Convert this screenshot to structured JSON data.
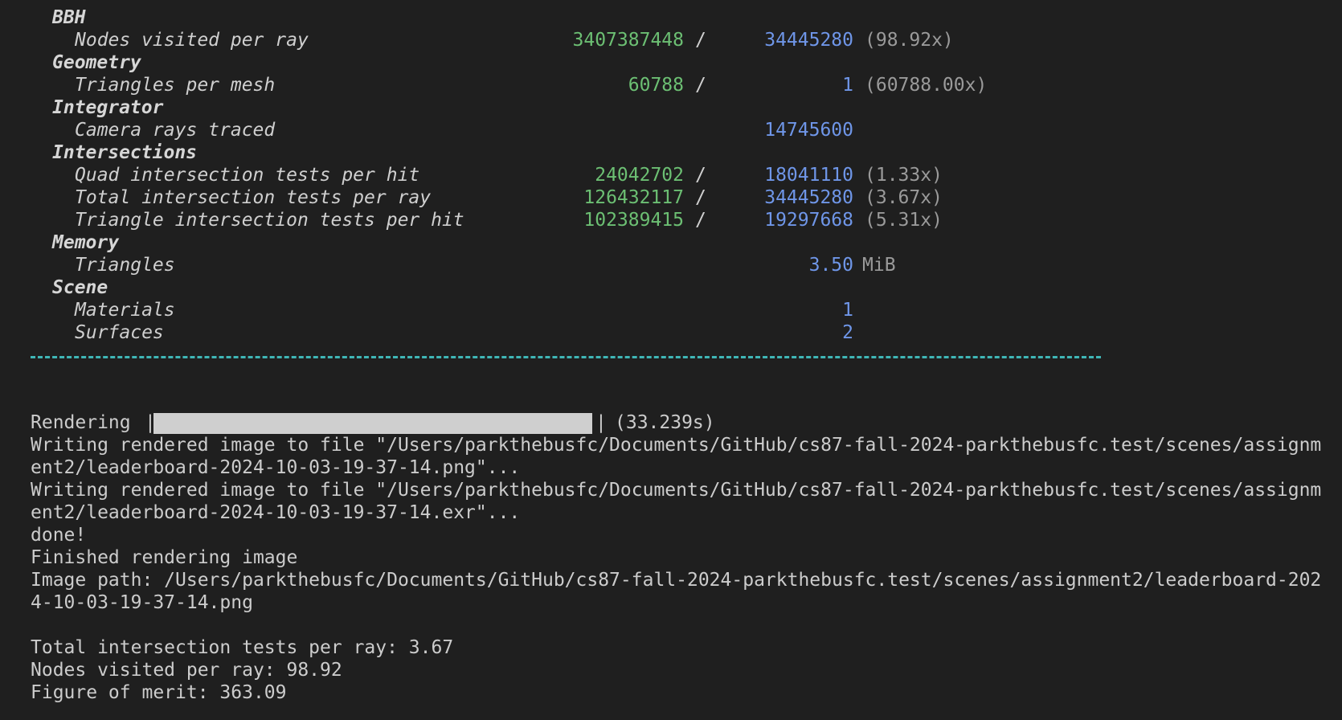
{
  "stats": {
    "bbh": {
      "category": "BBH",
      "nodes_label": "Nodes visited per ray",
      "nodes_num": "3407387448",
      "nodes_den": "34445280",
      "nodes_ratio": "(98.92x)"
    },
    "geometry": {
      "category": "Geometry",
      "tri_label": "Triangles per mesh",
      "tri_num": "60788",
      "tri_den": "1",
      "tri_ratio": "(60788.00x)"
    },
    "integrator": {
      "category": "Integrator",
      "rays_label": "Camera rays traced",
      "rays_value": "14745600"
    },
    "intersections": {
      "category": "Intersections",
      "quad_label": "Quad intersection tests per hit",
      "quad_num": "24042702",
      "quad_den": "18041110",
      "quad_ratio": "(1.33x)",
      "total_label": "Total intersection tests per ray",
      "total_num": "126432117",
      "total_den": "34445280",
      "total_ratio": "(3.67x)",
      "triangle_label": "Triangle intersection tests per hit",
      "triangle_num": "102389415",
      "triangle_den": "19297668",
      "triangle_ratio": "(5.31x)"
    },
    "memory": {
      "category": "Memory",
      "tri_label": "Triangles",
      "tri_value": "3.50",
      "tri_unit": "MiB"
    },
    "scene": {
      "category": "Scene",
      "materials_label": "Materials",
      "materials_value": "1",
      "surfaces_label": "Surfaces",
      "surfaces_value": "2"
    },
    "slash": "/"
  },
  "render": {
    "label": "Rendering",
    "pipe": "|",
    "progress_fraction": 1.0,
    "duration": "(33.239s)"
  },
  "log": [
    "Writing rendered image to file \"/Users/parkthebusfc/Documents/GitHub/cs87-fall-2024-parkthebusfc.test/scenes/assignm",
    "ent2/leaderboard-2024-10-03-19-37-14.png\"...",
    "Writing rendered image to file \"/Users/parkthebusfc/Documents/GitHub/cs87-fall-2024-parkthebusfc.test/scenes/assignm",
    "ent2/leaderboard-2024-10-03-19-37-14.exr\"...",
    "done!",
    "Finished rendering image",
    "Image path: /Users/parkthebusfc/Documents/GitHub/cs87-fall-2024-parkthebusfc.test/scenes/assignment2/leaderboard-202",
    "4-10-03-19-37-14.png"
  ],
  "summary": [
    "Total intersection tests per ray: 3.67",
    "Nodes visited per ray: 98.92",
    "Figure of merit: 363.09"
  ],
  "colors": {
    "background": "#1f1f1f",
    "numerator": "#6cbf73",
    "denominator": "#6f96e8",
    "divider": "#3fb6b6"
  }
}
